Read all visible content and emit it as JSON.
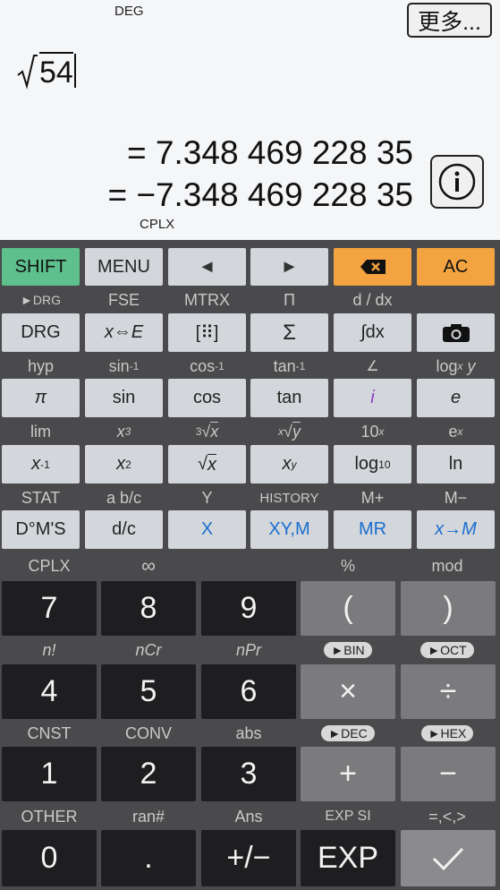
{
  "display": {
    "mode": "DEG",
    "more_label": "更多...",
    "expression": "54",
    "result1": "= 7.348 469 228 35",
    "result2": "= −7.348 469 228 35",
    "cplx_label": "CPLX"
  },
  "row1": {
    "shift": "SHIFT",
    "menu": "MENU",
    "left": "◄",
    "right": "►",
    "ac": "AC"
  },
  "sec1": {
    "drg2": "►DRG",
    "fse": "FSE",
    "mtrx": "MTRX",
    "pi_prod": "Π",
    "ddx": "d / dx"
  },
  "row2": {
    "drg": "DRG",
    "xe": "x⇔E",
    "matrix": "[⠿]",
    "sigma": "Σ",
    "integral": "∫dx"
  },
  "sec2": {
    "hyp": "hyp",
    "asin": "sin",
    "acos": "cos",
    "atan": "tan",
    "angle": "∠",
    "logxy": "log"
  },
  "row3": {
    "pi": "π",
    "sin": "sin",
    "cos": "cos",
    "tan": "tan",
    "i": "i",
    "e": "e"
  },
  "sec3": {
    "lim": "lim",
    "x3": "x",
    "cbrt": "x",
    "xrooty": "y",
    "tenx": "10",
    "ex": "e"
  },
  "row4": {
    "xinv": "x",
    "x2": "x",
    "sqrt": "x",
    "xy": "x",
    "log10": "log",
    "ln": "ln"
  },
  "sec4": {
    "stat": "STAT",
    "abc": "a b/c",
    "y": "Y",
    "history": "HISTORY",
    "mplus": "M+",
    "mminus": "M−"
  },
  "row5": {
    "dms": "D°M'S",
    "dc": "d/c",
    "x": "X",
    "xym": "XY,M",
    "mr": "MR",
    "xtom": "x→M"
  },
  "sec5": {
    "cplx": "CPLX",
    "inf": "∞",
    "pct": "%",
    "mod": "mod"
  },
  "row6": {
    "k7": "7",
    "k8": "8",
    "k9": "9",
    "lp": "(",
    "rp": ")"
  },
  "sec6": {
    "fact": "n!",
    "ncr": "nCr",
    "npr": "nPr",
    "bin": "►BIN",
    "oct": "►OCT"
  },
  "row7": {
    "k4": "4",
    "k5": "5",
    "k6": "6",
    "mul": "×",
    "div": "÷"
  },
  "sec7": {
    "cnst": "CNST",
    "conv": "CONV",
    "abs": "abs",
    "dec": "►DEC",
    "hex": "►HEX"
  },
  "row8": {
    "k1": "1",
    "k2": "2",
    "k3": "3",
    "plus": "+",
    "minus": "−"
  },
  "sec8": {
    "other": "OTHER",
    "ran": "ran#",
    "ans": "Ans",
    "expsi": "EXP SI",
    "cmp": "=,<,>"
  },
  "row9": {
    "k0": "0",
    "dot": ".",
    "neg": "+/−",
    "exp": "EXP",
    "ok": "✓"
  },
  "colors": {
    "shift": "#5ec08c",
    "orange": "#f3a33f",
    "blue": "#1a6fd0",
    "panel": "#4a4a4c"
  }
}
